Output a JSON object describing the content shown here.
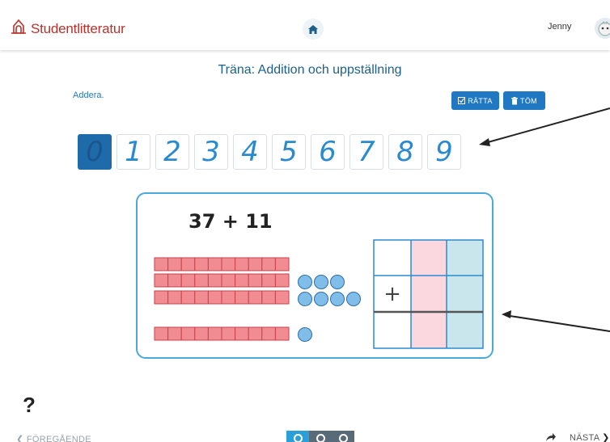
{
  "header": {
    "brand": "Studentlitteratur",
    "user_name": "Jenny",
    "icons": [
      "brand-logo-icon",
      "home-icon",
      "avatar"
    ]
  },
  "exercise": {
    "title": "Träna: Addition och uppställning",
    "instruction": "Addera.",
    "check_button": "RÄTTA",
    "clear_button": "TÖM"
  },
  "digits": [
    {
      "label": "0",
      "selected": true
    },
    {
      "label": "1",
      "selected": false
    },
    {
      "label": "2",
      "selected": false
    },
    {
      "label": "3",
      "selected": false
    },
    {
      "label": "4",
      "selected": false
    },
    {
      "label": "5",
      "selected": false
    },
    {
      "label": "6",
      "selected": false
    },
    {
      "label": "7",
      "selected": false
    },
    {
      "label": "8",
      "selected": false
    },
    {
      "label": "9",
      "selected": false
    }
  ],
  "task": {
    "expression": "37 + 11",
    "operator": "+",
    "first_addend": {
      "tens": 3,
      "ones": 7
    },
    "second_addend": {
      "tens": 1,
      "ones": 1
    }
  },
  "footer": {
    "help": "?",
    "prev_label": "FÖREGÅENDE",
    "next_label": "NÄSTA",
    "pages_total": 3,
    "current_page": 1
  },
  "colors": {
    "brand": "#b9312b",
    "primary": "#2077c2",
    "card_border": "#4ba8da",
    "tens_fill": "#f28c93",
    "ones_fill": "#80bde8",
    "tens_column": "#fbd8df",
    "ones_column": "#c8e6ec"
  }
}
